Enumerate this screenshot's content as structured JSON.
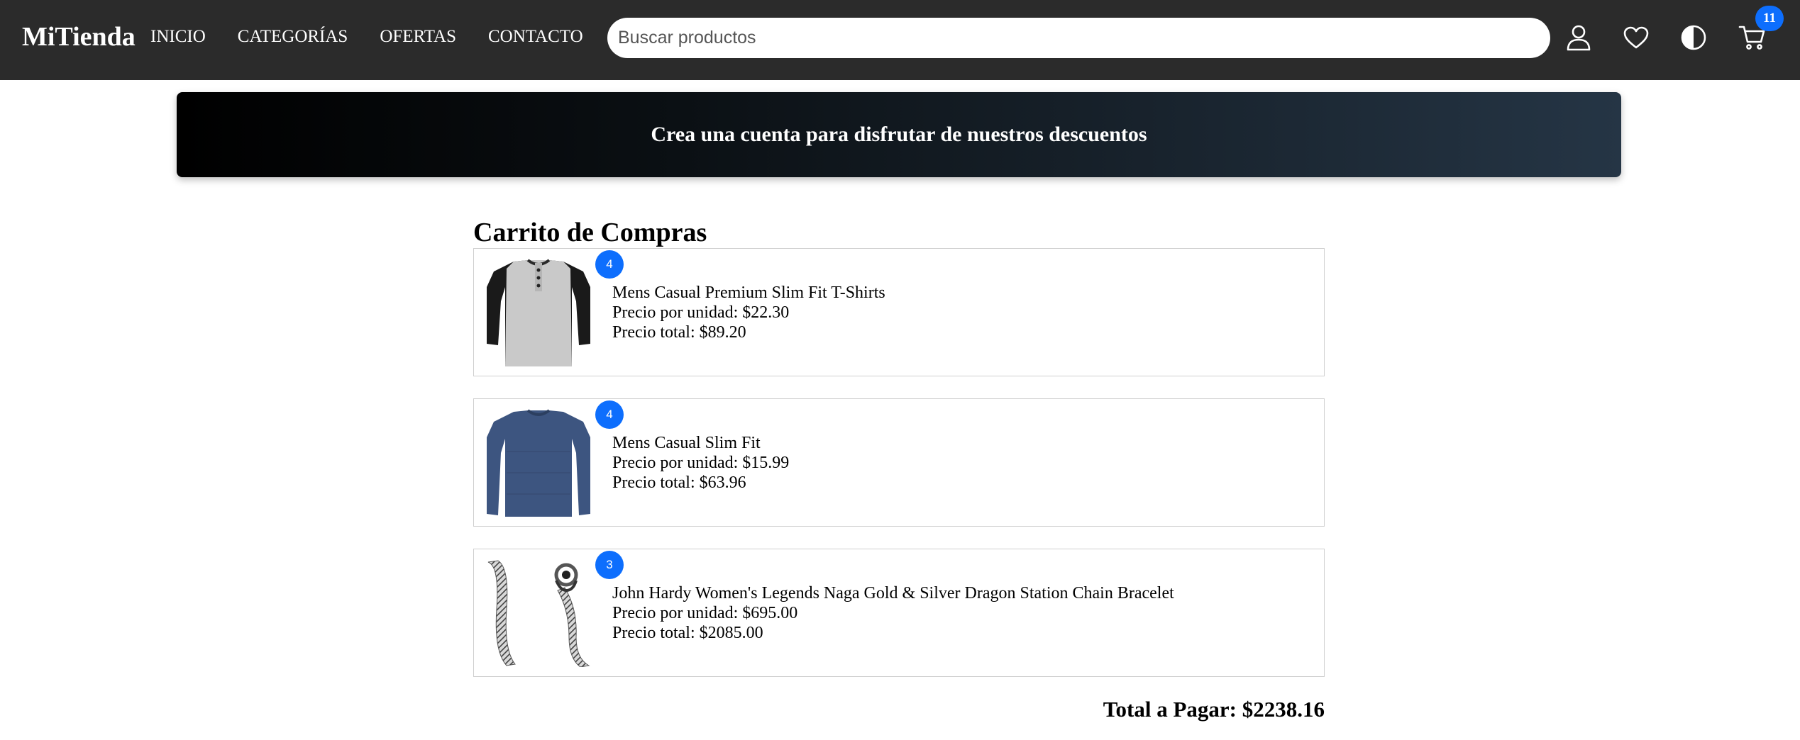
{
  "header": {
    "logo": "MiTienda",
    "nav": [
      "INICIO",
      "CATEGORÍAS",
      "OFERTAS",
      "CONTACTO"
    ],
    "search_placeholder": "Buscar productos",
    "icons": [
      "user-icon",
      "heart-icon",
      "theme-toggle-icon",
      "cart-icon"
    ],
    "cart_count": "11"
  },
  "banner": {
    "text": "Crea una cuenta para disfrutar de nuestros descuentos"
  },
  "cart": {
    "title": "Carrito de Compras",
    "items": [
      {
        "quantity": "4",
        "name": "Mens Casual Premium Slim Fit T-Shirts",
        "unit_price": "Precio por unidad: $22.30",
        "total_price": "Precio total: $89.20"
      },
      {
        "quantity": "4",
        "name": "Mens Casual Slim Fit",
        "unit_price": "Precio por unidad: $15.99",
        "total_price": "Precio total: $63.96"
      },
      {
        "quantity": "3",
        "name": "John Hardy Women's Legends Naga Gold & Silver Dragon Station Chain Bracelet",
        "unit_price": "Precio por unidad: $695.00",
        "total_price": "Precio total: $2085.00"
      }
    ],
    "total": "Total a Pagar: $2238.16"
  },
  "colors": {
    "header_bg": "#2b2b2b",
    "accent": "#0d6efd",
    "banner_start": "#000000",
    "banner_end": "#253545"
  }
}
